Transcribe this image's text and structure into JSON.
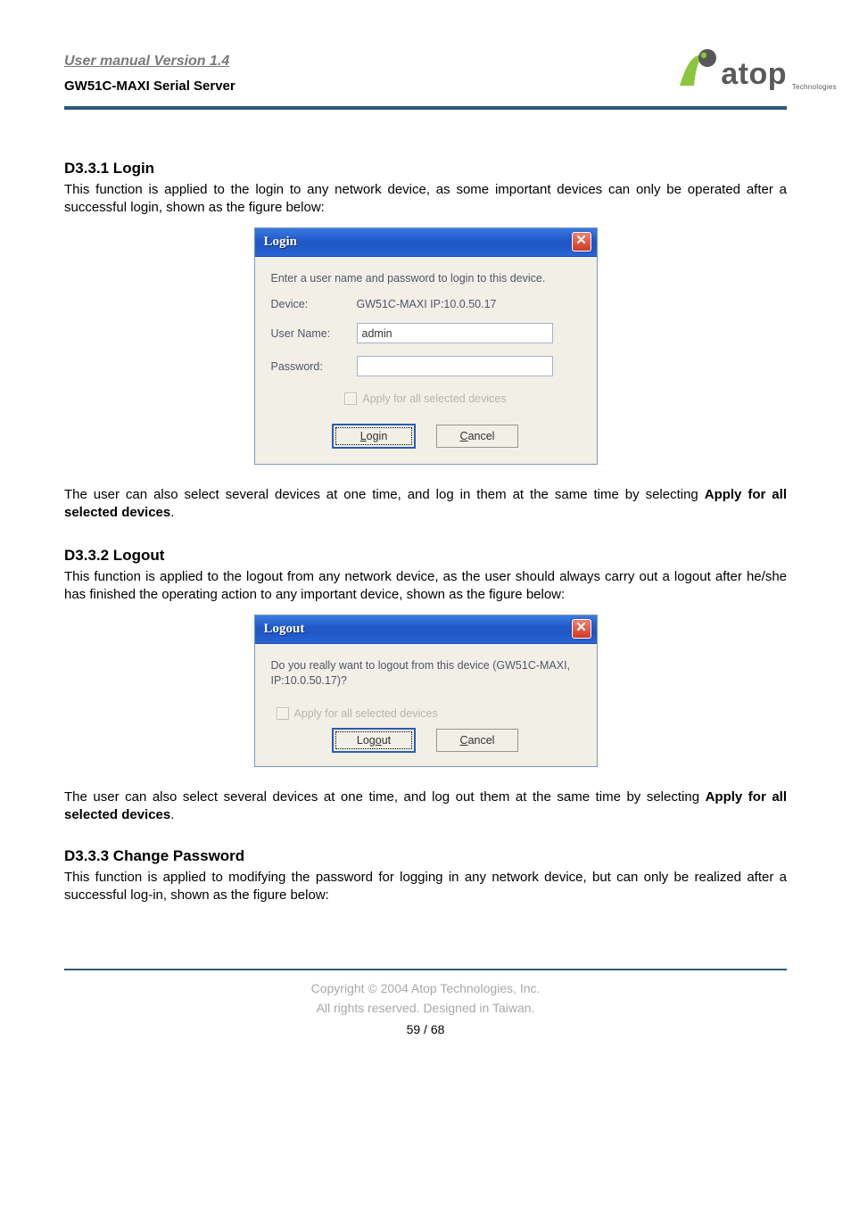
{
  "header": {
    "line1": "User manual Version 1.4",
    "line2": "GW51C-MAXI Serial Server",
    "logo_text": "atop",
    "logo_sub": "Technologies"
  },
  "sections": {
    "login": {
      "heading": "D3.3.1 Login",
      "para": "This function is applied to the login to any network device, as some important devices can only be operated after a successful login, shown as the figure below:",
      "after1": "The user can also select several devices at one time, and log in them at the same time by selecting ",
      "after_bold": "Apply for all selected devices",
      "after2": "."
    },
    "logout": {
      "heading": "D3.3.2 Logout",
      "para": "This function is applied to the logout from any network device, as the user should always carry out a logout after he/she has finished the operating action to any important device, shown as the figure below:",
      "after1": "The user can also select several devices at one time, and log out them at the same time by selecting ",
      "after_bold": "Apply for all selected devices",
      "after2": "."
    },
    "changepw": {
      "heading": "D3.3.3 Change Password",
      "para": "This function is applied to modifying the password for logging in any network device, but can only be realized after a successful log-in, shown as the figure below:"
    }
  },
  "login_dialog": {
    "title": "Login",
    "prompt": "Enter a user name and password to login to this device.",
    "device_label": "Device:",
    "device_value": "GW51C-MAXI   IP:10.0.50.17",
    "username_label": "User Name:",
    "username_value": "admin",
    "password_label": "Password:",
    "password_value": "",
    "apply_label": "Apply for all selected devices",
    "login_btn_pre": "L",
    "login_btn_rest": "ogin",
    "cancel_btn_pre": "C",
    "cancel_btn_rest": "ancel"
  },
  "logout_dialog": {
    "title": "Logout",
    "prompt": "Do you really want to logout from this device (GW51C-MAXI, IP:10.0.50.17)?",
    "apply_label": "Apply for all selected devices",
    "logout_btn_text": "Log",
    "logout_btn_u": "o",
    "logout_btn_rest": "ut",
    "cancel_btn_pre": "C",
    "cancel_btn_rest": "ancel"
  },
  "footer": {
    "line1": "Copyright © 2004 Atop Technologies, Inc.",
    "line2": "All rights reserved. Designed in Taiwan.",
    "pagenum": "59 / 68"
  }
}
